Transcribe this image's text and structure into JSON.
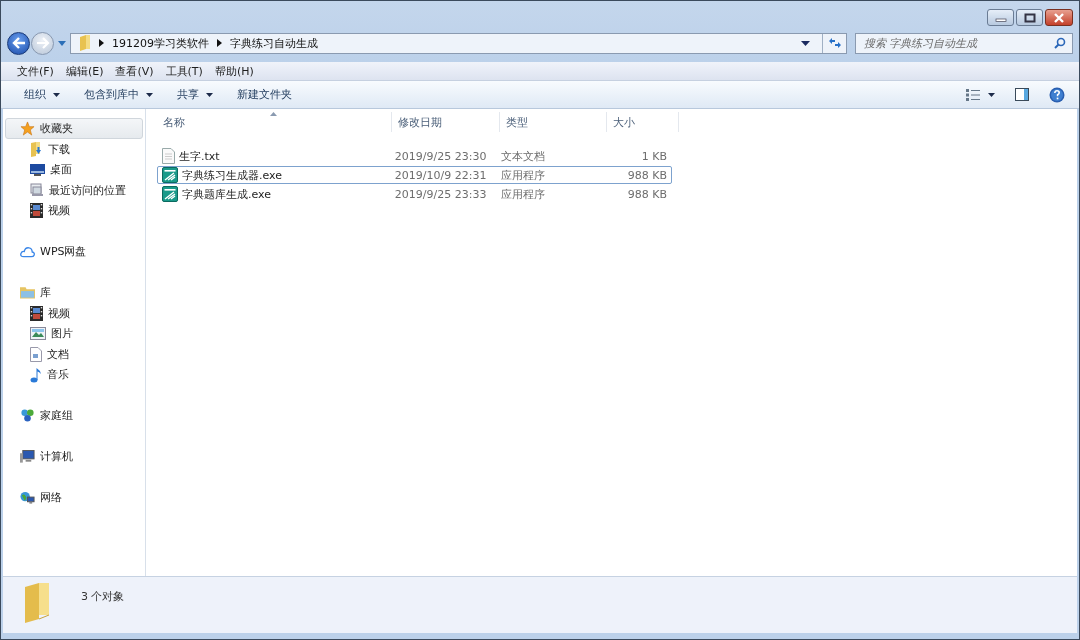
{
  "address": {
    "crumbs": [
      "191209学习类软件",
      "字典练习自动生成"
    ]
  },
  "search": {
    "placeholder": "搜索 字典练习自动生成"
  },
  "menu": [
    "文件(F)",
    "编辑(E)",
    "查看(V)",
    "工具(T)",
    "帮助(H)"
  ],
  "toolbar": [
    {
      "label": "组织",
      "dropdown": true
    },
    {
      "label": "包含到库中",
      "dropdown": true
    },
    {
      "label": "共享",
      "dropdown": true
    },
    {
      "label": "新建文件夹",
      "dropdown": false
    }
  ],
  "sidebar": {
    "groups": [
      {
        "label": "收藏夹",
        "selected": true,
        "children": [
          {
            "label": "下载"
          },
          {
            "label": "桌面"
          },
          {
            "label": "最近访问的位置"
          },
          {
            "label": "视频"
          }
        ]
      },
      {
        "label": "WPS网盘",
        "selected": false
      },
      {
        "label": "库",
        "selected": false,
        "children": [
          {
            "label": "视频"
          },
          {
            "label": "图片"
          },
          {
            "label": "文档"
          },
          {
            "label": "音乐"
          }
        ]
      },
      {
        "label": "家庭组",
        "selected": false
      },
      {
        "label": "计算机",
        "selected": false
      },
      {
        "label": "网络",
        "selected": false
      }
    ]
  },
  "table": {
    "columns": [
      "名称",
      "修改日期",
      "类型",
      "大小"
    ],
    "rows": [
      {
        "kind": "text",
        "focused": false,
        "cells": [
          "生字.txt",
          "2019/9/25 23:30",
          "文本文档",
          "1 KB"
        ]
      },
      {
        "kind": "app",
        "focused": true,
        "cells": [
          "字典练习生成器.exe",
          "2019/10/9 22:31",
          "应用程序",
          "988 KB"
        ]
      },
      {
        "kind": "app",
        "focused": false,
        "cells": [
          "字典题库生成.exe",
          "2019/9/25 23:33",
          "应用程序",
          "988 KB"
        ]
      }
    ]
  },
  "status_bar": {
    "text": "3 个对象"
  }
}
